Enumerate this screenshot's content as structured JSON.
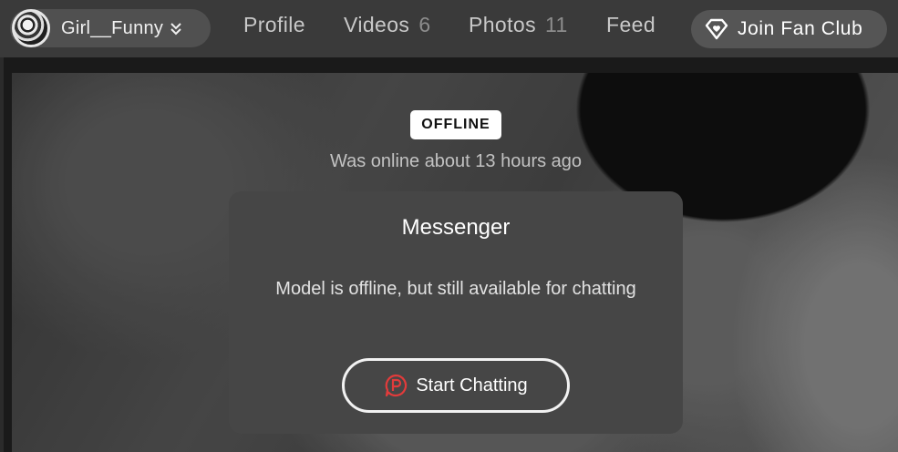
{
  "header": {
    "username": "Girl__Funny",
    "nav": [
      {
        "label": "Profile",
        "count": ""
      },
      {
        "label": "Videos",
        "count": "6"
      },
      {
        "label": "Photos",
        "count": "11"
      },
      {
        "label": "Feed",
        "count": ""
      }
    ],
    "fan_club_label": "Join Fan Club"
  },
  "status": {
    "badge": "OFFLINE",
    "last_online": "Was online about 13 hours ago"
  },
  "messenger": {
    "title": "Messenger",
    "text": "Model is offline, but still available for chatting",
    "button_label": "Start Chatting",
    "button_icon": "chat-p-icon",
    "icon_color": "#e23b3b"
  },
  "colors": {
    "topbar": "#3a3a3a",
    "pill": "#505050",
    "card": "#464646"
  }
}
